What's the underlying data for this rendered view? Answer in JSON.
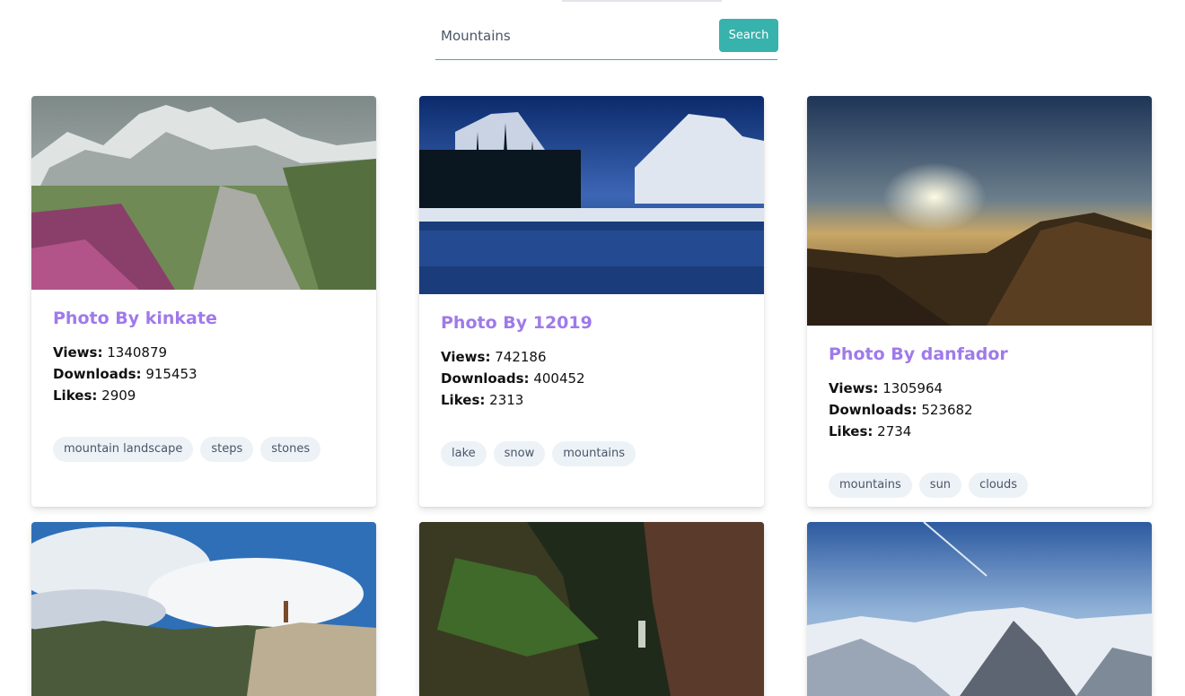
{
  "search": {
    "value": "Mountains",
    "button_label": "Search"
  },
  "cards": [
    {
      "title": "Photo By kinkate",
      "views_label": "Views:",
      "views": "1340879",
      "downloads_label": "Downloads:",
      "downloads": "915453",
      "likes_label": "Likes:",
      "likes": "2909",
      "tags": [
        "mountain landscape",
        "steps",
        "stones"
      ]
    },
    {
      "title": "Photo By 12019",
      "views_label": "Views:",
      "views": "742186",
      "downloads_label": "Downloads:",
      "downloads": "400452",
      "likes_label": "Likes:",
      "likes": "2313",
      "tags": [
        "lake",
        "snow",
        "mountains"
      ]
    },
    {
      "title": "Photo By danfador",
      "views_label": "Views:",
      "views": "1305964",
      "downloads_label": "Downloads:",
      "downloads": "523682",
      "likes_label": "Likes:",
      "likes": "2734",
      "tags": [
        "mountains",
        "sun",
        "clouds"
      ]
    }
  ],
  "colors": {
    "accent_teal": "#38b2ac",
    "title_purple": "#9f7aea",
    "tag_bg": "#edf2f7",
    "tag_text": "#4a5568"
  }
}
